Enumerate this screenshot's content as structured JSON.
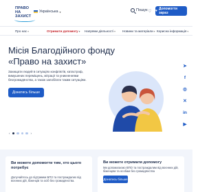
{
  "header": {
    "logo_line1": "ПРАВО НА",
    "logo_line2": "ЗАХИСТ",
    "language": "Українська",
    "search_label": "Пошук",
    "help_button": "Допомогти зараз"
  },
  "nav": {
    "items": [
      {
        "label": "Про нас"
      },
      {
        "label": "Отримати допомогу"
      },
      {
        "label": "Напрями діяльності"
      },
      {
        "label": "Новини та матеріали"
      },
      {
        "label": "Корисна інформація"
      }
    ]
  },
  "hero": {
    "title": "Місія Благодійного фонду «Право на захист»",
    "text": "Захищати людей в ситуаціях конфліктів, катастроф, вимушених переміщень, міграції та уникненнями безгромадянства, а також запобігати таким ситуаціям.",
    "button": "Дізнатись більше",
    "arrow_prev": "‹",
    "arrow_next": "›"
  },
  "social": [
    "telegram-icon",
    "facebook-icon",
    "instagram-icon",
    "twitter-icon",
    "linkedin-icon",
    "youtube-icon"
  ],
  "cards": {
    "left": {
      "title": "Ви можете допомогти тим, хто цього потребує",
      "text": "Долучайтесь до підтримки БПЗ та постраждалих від воєнних дій, біженців та осіб без громадянства."
    },
    "right": {
      "title": "Ви можете отримати допомогу",
      "text": "Ми допомагаємо ВПО та постраждалим від воєнних дій, біженцям та особам без громадянства",
      "button": "Дізнатись більше"
    }
  },
  "colors": {
    "brand_blue": "#1e5bc6",
    "active_nav": "#c4232b",
    "text_dark": "#1c2b4a"
  }
}
